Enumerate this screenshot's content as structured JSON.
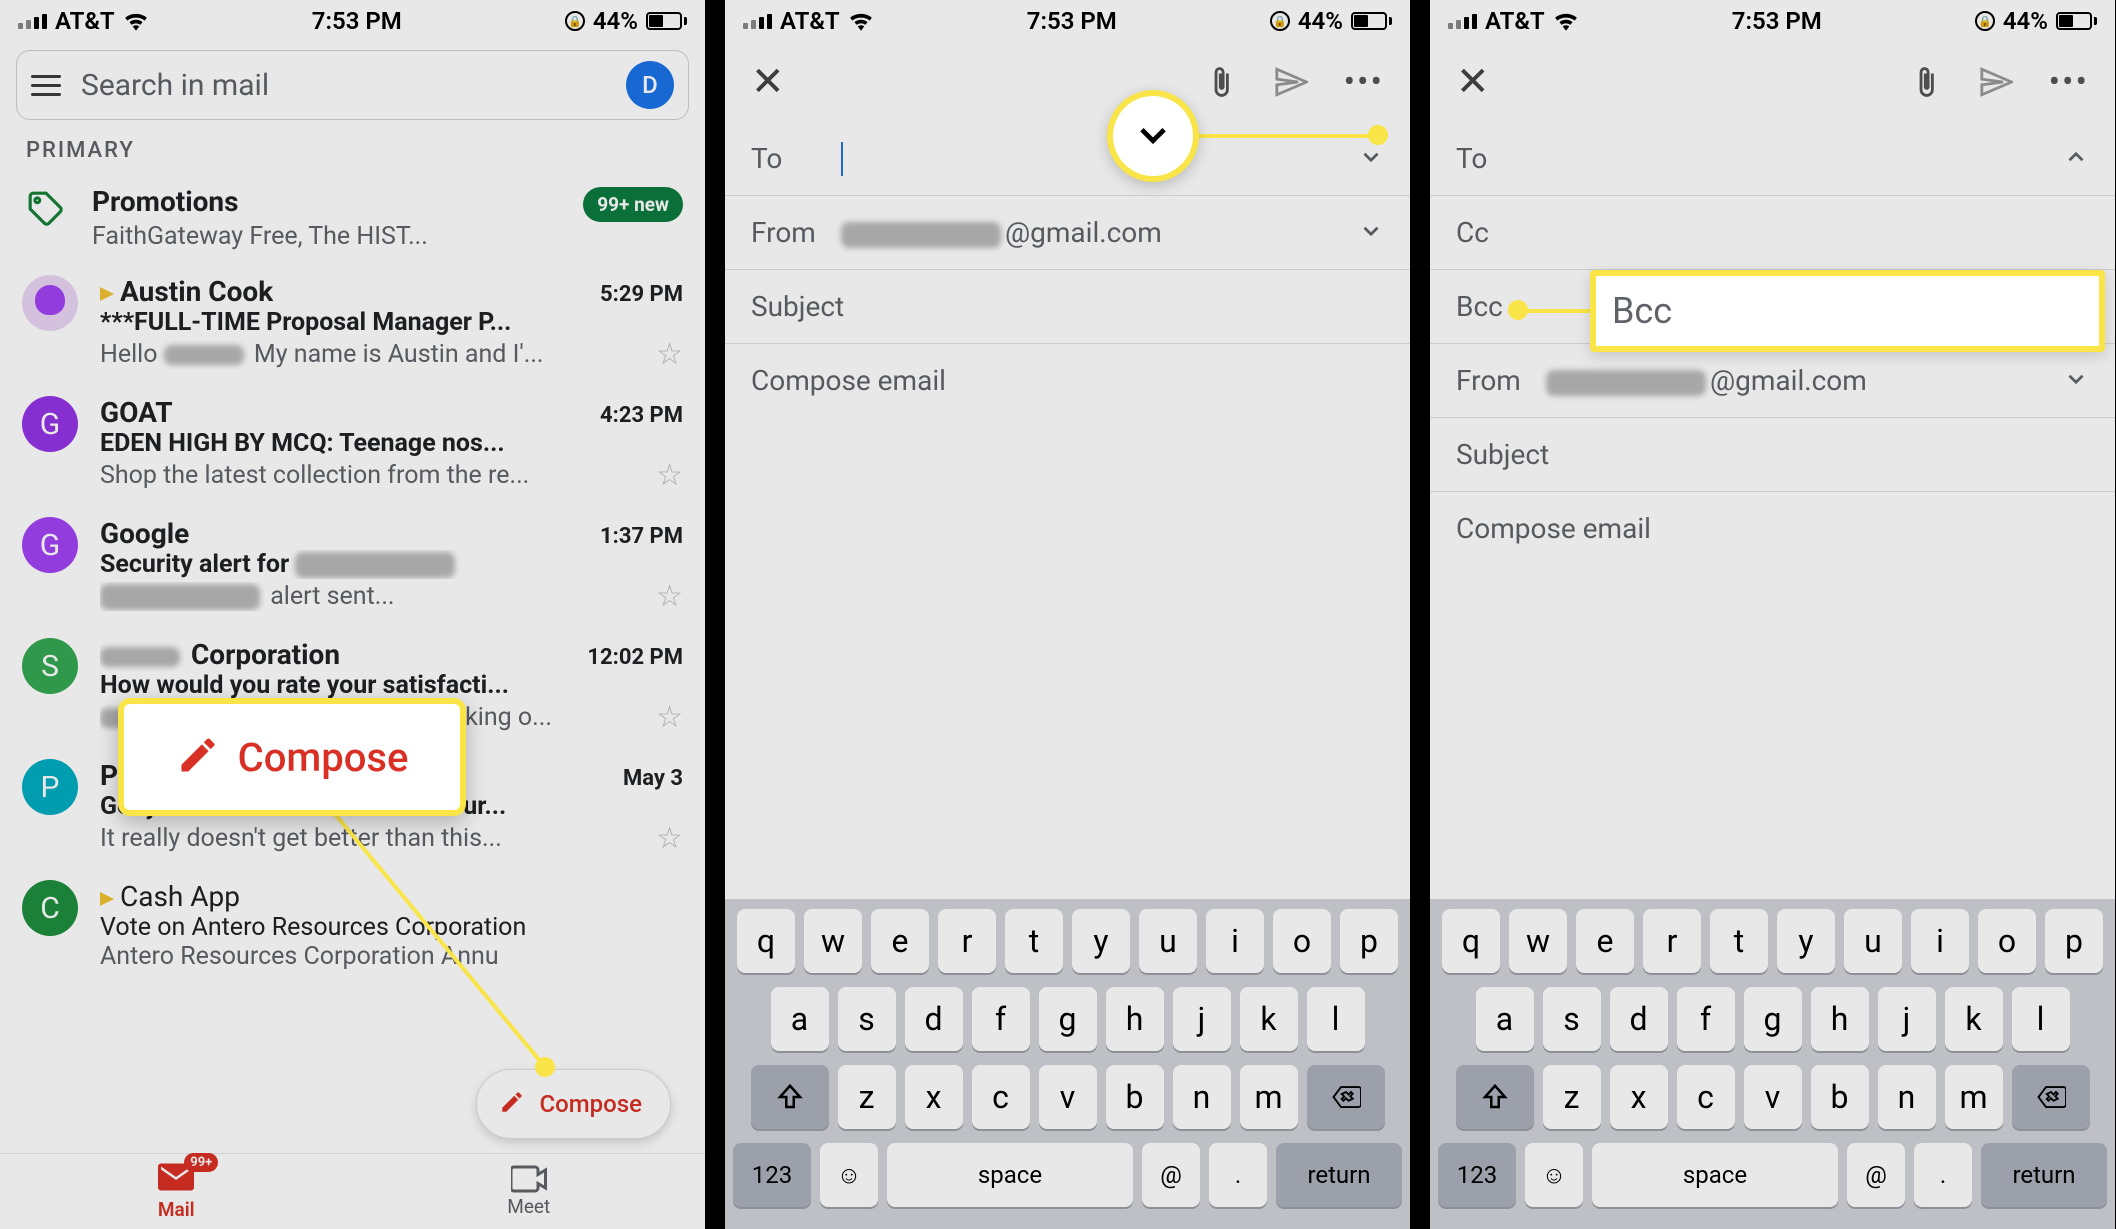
{
  "status": {
    "carrier": "AT&T",
    "time": "7:53 PM",
    "battery": "44%"
  },
  "screen1": {
    "search_placeholder": "Search in mail",
    "avatar_initial": "D",
    "section": "PRIMARY",
    "promo": {
      "title": "Promotions",
      "subtitle": "FaithGateway Free, The HIST...",
      "badge": "99+ new"
    },
    "messages": [
      {
        "sender": "Austin Cook",
        "date": "5:29 PM",
        "subject": "***FULL-TIME Proposal Manager P...",
        "snippet": "Hello ▉▉ My name is Austin and I'...",
        "important": true,
        "avatar": "img"
      },
      {
        "sender": "GOAT",
        "date": "4:23 PM",
        "subject": "EDEN HIGH BY MCQ: Teenage nos...",
        "snippet": "Shop the latest collection from the re...",
        "avatar": "G",
        "color": "purple"
      },
      {
        "sender": "Google",
        "date": "1:37 PM",
        "subject": "Security alert for ▉▉▉▉",
        "snippet": "▉▉▉▉▉▉▉ alert sent...",
        "avatar": "G",
        "color": "pp"
      },
      {
        "sender": "▉▉ Corporation",
        "date": "12:02 PM",
        "subject": "How would you rate your satisfacti...",
        "snippet": "▉▉, share your insights by taking o...",
        "avatar": "S",
        "color": "green"
      },
      {
        "sender": "Planet Fitness",
        "date": "May 3",
        "subject": "Get your first month FREE with our...",
        "snippet": "It really doesn't get better than this...",
        "avatar": "P",
        "color": "blue"
      },
      {
        "sender": "Cash App",
        "date": "",
        "subject": "Vote on Antero Resources Corporation",
        "snippet": "Antero Resources Corporation Annu",
        "avatar": "C",
        "color": "gr2",
        "important": true,
        "read": true
      }
    ],
    "compose_label": "Compose",
    "nav": {
      "mail": "Mail",
      "meet": "Meet",
      "mail_badge": "99+"
    }
  },
  "compose": {
    "to": "To",
    "cc": "Cc",
    "bcc": "Bcc",
    "from": "From",
    "from_value": "@gmail.com",
    "subject": "Subject",
    "body_ph": "Compose email"
  },
  "keyboard": {
    "row1": [
      "q",
      "w",
      "e",
      "r",
      "t",
      "y",
      "u",
      "i",
      "o",
      "p"
    ],
    "row2": [
      "a",
      "s",
      "d",
      "f",
      "g",
      "h",
      "j",
      "k",
      "l"
    ],
    "row3": [
      "z",
      "x",
      "c",
      "v",
      "b",
      "n",
      "m"
    ],
    "k123": "123",
    "space": "space",
    "at": "@",
    "dot": ".",
    "ret": "return"
  },
  "highlight": {
    "bcc_label": "Bcc"
  }
}
